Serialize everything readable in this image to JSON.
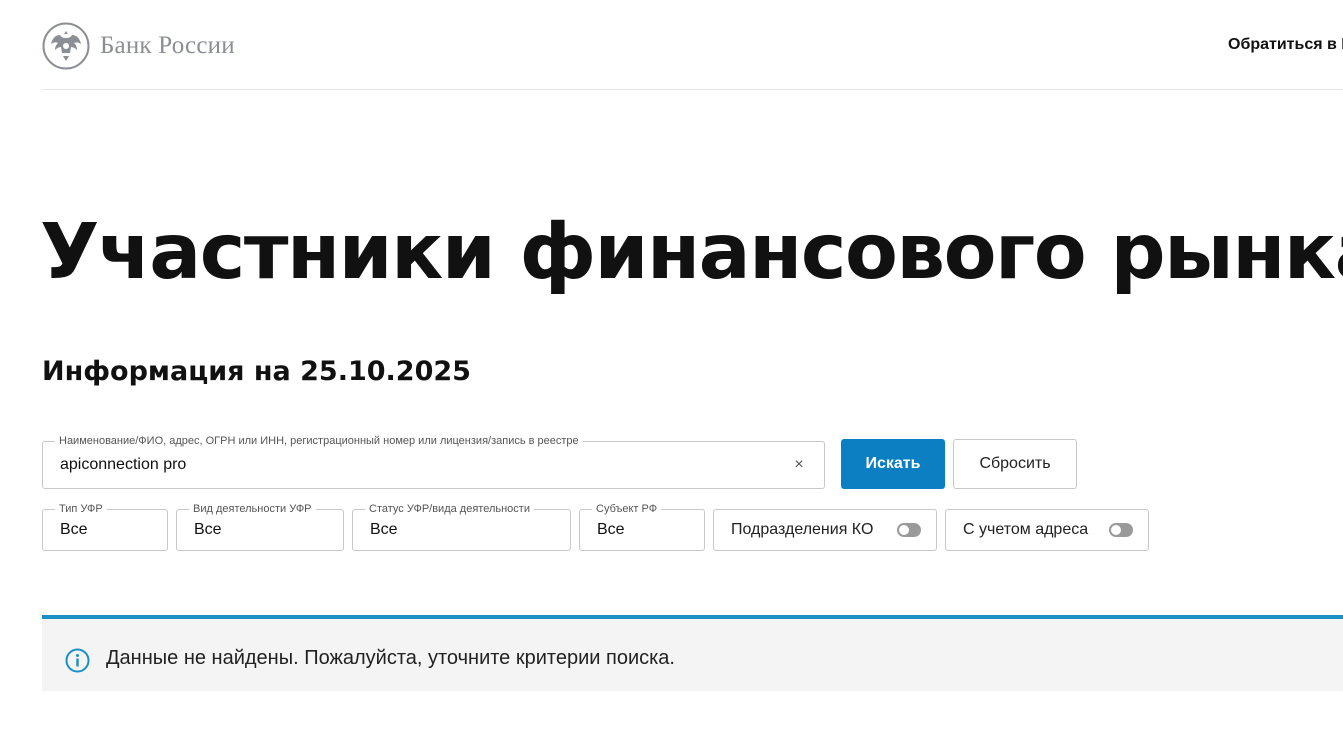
{
  "header": {
    "logo_text": "Банк России",
    "contact_link": "Обратиться в Б"
  },
  "page": {
    "title": "Участники финансового рынка",
    "info_date": "Информация на 25.10.2025"
  },
  "search": {
    "label": "Наименование/ФИО, адрес, ОГРН или ИНН, регистрационный номер или лицензия/запись в реестре",
    "value": "apiconnection pro",
    "clear_symbol": "×",
    "search_button": "Искать",
    "reset_button": "Сбросить"
  },
  "filters": [
    {
      "label": "Тип УФР",
      "value": "Все"
    },
    {
      "label": "Вид деятельности УФР",
      "value": "Все"
    },
    {
      "label": "Статус УФР/вида деятельности",
      "value": "Все"
    },
    {
      "label": "Субъект РФ",
      "value": "Все"
    }
  ],
  "toggles": [
    {
      "label": "Подразделения КО",
      "on": false
    },
    {
      "label": "С учетом адреса",
      "on": false
    }
  ],
  "notice": {
    "text": "Данные не найдены. Пожалуйста, уточните критерии поиска.",
    "icon": "info-icon"
  },
  "colors": {
    "accent": "#0b7fc1",
    "notice_border": "#1a8fc4",
    "notice_bg": "#f4f4f4",
    "logo_gray": "#8b8f95"
  }
}
